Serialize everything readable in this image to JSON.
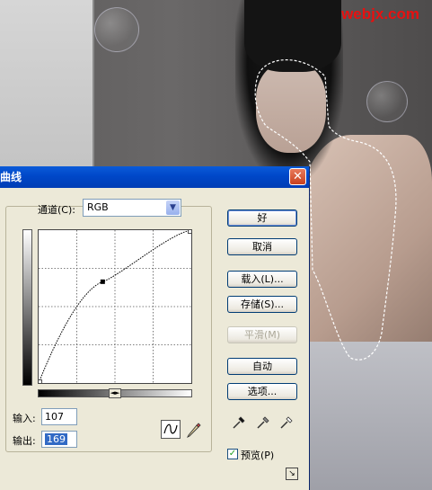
{
  "watermark": "webjx.com",
  "dialog": {
    "title": "曲线",
    "close_glyph": "✕",
    "channel": {
      "label": "通道(C):",
      "value": "RGB"
    },
    "curve": {
      "input": 107,
      "output": 169,
      "point_count": 3
    },
    "input_label": "输入:",
    "output_label": "输出:",
    "input_value": "107",
    "output_value": "169",
    "buttons": {
      "ok": "好",
      "cancel": "取消",
      "load": "载入(L)...",
      "save": "存储(S)...",
      "smooth": "平滑(M)",
      "auto": "自动",
      "options": "选项..."
    },
    "preview": {
      "label": "预览(P)",
      "checked": true
    }
  },
  "colors": {
    "title_bar": "#0047c8",
    "dialog_bg": "#ece9d8",
    "selection": "#316ac5",
    "watermark": "#e81010"
  }
}
